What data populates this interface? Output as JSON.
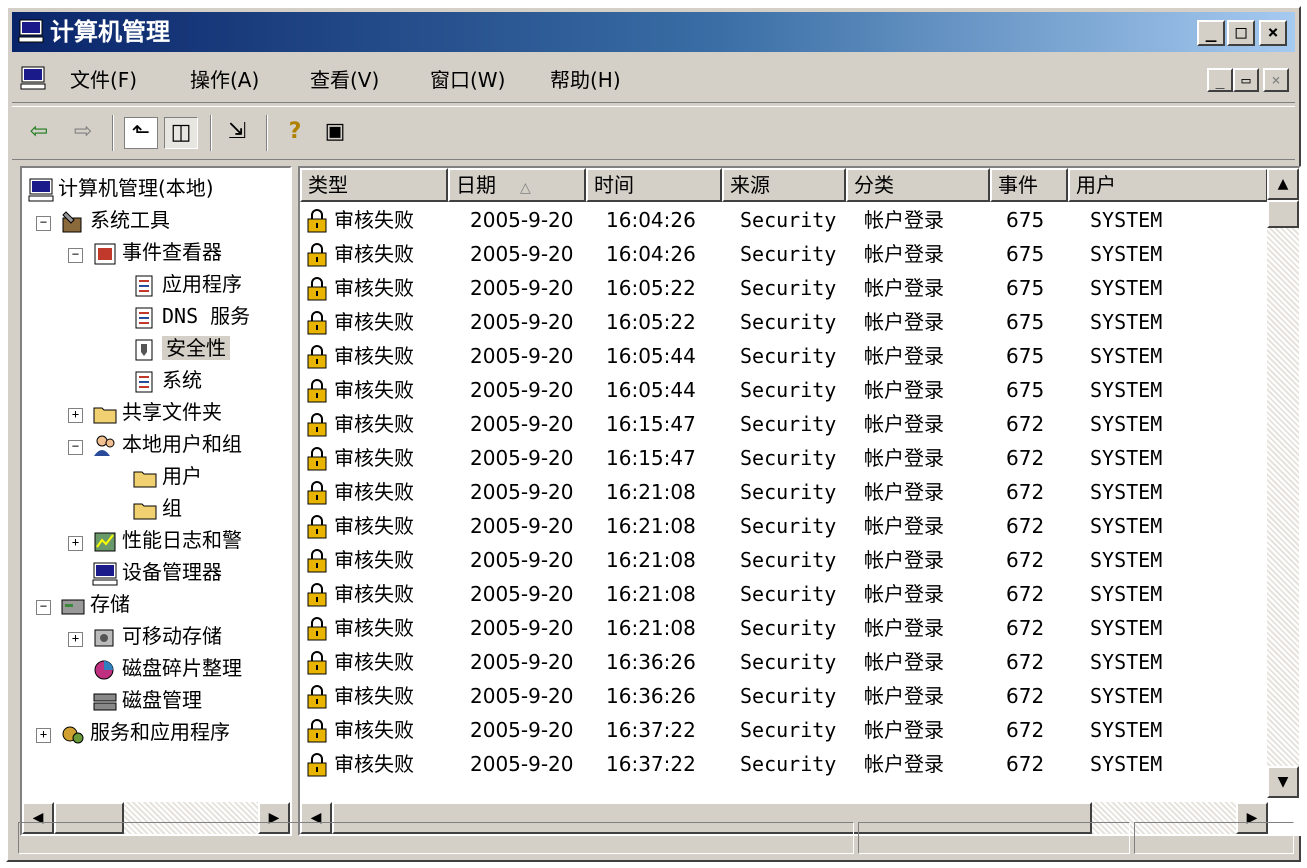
{
  "window": {
    "title": "计算机管理"
  },
  "title_buttons": {
    "minimize": "_",
    "maximize": "□",
    "close": "×"
  },
  "menu": [
    {
      "label": "文件(F)"
    },
    {
      "label": "操作(A)"
    },
    {
      "label": "查看(V)"
    },
    {
      "label": "窗口(W)"
    },
    {
      "label": "帮助(H)"
    }
  ],
  "mdi_buttons": {
    "minimize": "_",
    "restore": "▭",
    "close": "×"
  },
  "toolbar": {
    "back": "⇦",
    "forward": "⇨",
    "up": "⬑",
    "toggle_tree": "◫",
    "export": "⇲",
    "help": "?",
    "properties": "▣"
  },
  "tree": {
    "root": "计算机管理(本地)",
    "items": [
      {
        "label": "系统工具"
      },
      {
        "label": "事件查看器"
      },
      {
        "label": "应用程序"
      },
      {
        "label": "DNS 服务"
      },
      {
        "label": "安全性"
      },
      {
        "label": "系统"
      },
      {
        "label": "共享文件夹"
      },
      {
        "label": "本地用户和组"
      },
      {
        "label": "用户"
      },
      {
        "label": "组"
      },
      {
        "label": "性能日志和警"
      },
      {
        "label": "设备管理器"
      },
      {
        "label": "存储"
      },
      {
        "label": "可移动存储"
      },
      {
        "label": "磁盘碎片整理"
      },
      {
        "label": "磁盘管理"
      },
      {
        "label": "服务和应用程序"
      }
    ]
  },
  "columns": [
    {
      "label": "类型"
    },
    {
      "label": "日期"
    },
    {
      "label": "时间"
    },
    {
      "label": "来源"
    },
    {
      "label": "分类"
    },
    {
      "label": "事件"
    },
    {
      "label": "用户"
    }
  ],
  "sort_indicator": "△",
  "rows": [
    {
      "type": "审核失败",
      "date": "2005-9-20",
      "time": "16:04:26",
      "source": "Security",
      "category": "帐户登录",
      "event": "675",
      "user": "SYSTEM"
    },
    {
      "type": "审核失败",
      "date": "2005-9-20",
      "time": "16:04:26",
      "source": "Security",
      "category": "帐户登录",
      "event": "675",
      "user": "SYSTEM"
    },
    {
      "type": "审核失败",
      "date": "2005-9-20",
      "time": "16:05:22",
      "source": "Security",
      "category": "帐户登录",
      "event": "675",
      "user": "SYSTEM"
    },
    {
      "type": "审核失败",
      "date": "2005-9-20",
      "time": "16:05:22",
      "source": "Security",
      "category": "帐户登录",
      "event": "675",
      "user": "SYSTEM"
    },
    {
      "type": "审核失败",
      "date": "2005-9-20",
      "time": "16:05:44",
      "source": "Security",
      "category": "帐户登录",
      "event": "675",
      "user": "SYSTEM"
    },
    {
      "type": "审核失败",
      "date": "2005-9-20",
      "time": "16:05:44",
      "source": "Security",
      "category": "帐户登录",
      "event": "675",
      "user": "SYSTEM"
    },
    {
      "type": "审核失败",
      "date": "2005-9-20",
      "time": "16:15:47",
      "source": "Security",
      "category": "帐户登录",
      "event": "672",
      "user": "SYSTEM"
    },
    {
      "type": "审核失败",
      "date": "2005-9-20",
      "time": "16:15:47",
      "source": "Security",
      "category": "帐户登录",
      "event": "672",
      "user": "SYSTEM"
    },
    {
      "type": "审核失败",
      "date": "2005-9-20",
      "time": "16:21:08",
      "source": "Security",
      "category": "帐户登录",
      "event": "672",
      "user": "SYSTEM"
    },
    {
      "type": "审核失败",
      "date": "2005-9-20",
      "time": "16:21:08",
      "source": "Security",
      "category": "帐户登录",
      "event": "672",
      "user": "SYSTEM"
    },
    {
      "type": "审核失败",
      "date": "2005-9-20",
      "time": "16:21:08",
      "source": "Security",
      "category": "帐户登录",
      "event": "672",
      "user": "SYSTEM"
    },
    {
      "type": "审核失败",
      "date": "2005-9-20",
      "time": "16:21:08",
      "source": "Security",
      "category": "帐户登录",
      "event": "672",
      "user": "SYSTEM"
    },
    {
      "type": "审核失败",
      "date": "2005-9-20",
      "time": "16:21:08",
      "source": "Security",
      "category": "帐户登录",
      "event": "672",
      "user": "SYSTEM"
    },
    {
      "type": "审核失败",
      "date": "2005-9-20",
      "time": "16:36:26",
      "source": "Security",
      "category": "帐户登录",
      "event": "672",
      "user": "SYSTEM"
    },
    {
      "type": "审核失败",
      "date": "2005-9-20",
      "time": "16:36:26",
      "source": "Security",
      "category": "帐户登录",
      "event": "672",
      "user": "SYSTEM"
    },
    {
      "type": "审核失败",
      "date": "2005-9-20",
      "time": "16:37:22",
      "source": "Security",
      "category": "帐户登录",
      "event": "672",
      "user": "SYSTEM"
    },
    {
      "type": "审核失败",
      "date": "2005-9-20",
      "time": "16:37:22",
      "source": "Security",
      "category": "帐户登录",
      "event": "672",
      "user": "SYSTEM"
    }
  ],
  "scroll_arrows": {
    "up": "▲",
    "down": "▼",
    "left": "◀",
    "right": "▶"
  },
  "colors": {
    "title_start": "#0a246a",
    "title_end": "#a6caf0",
    "face": "#d4d0c8",
    "lock": "#e8b400"
  }
}
